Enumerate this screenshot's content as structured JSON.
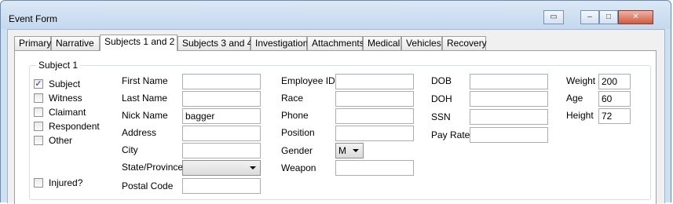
{
  "window": {
    "title": "Event Form",
    "buttons": {
      "restore_glyph": "▭",
      "minimize_glyph": "–",
      "maximize_glyph": "□",
      "close_glyph": "✕"
    }
  },
  "tabs": [
    "Primary",
    "Narrative",
    "Subjects 1 and 2",
    "Subjects 3 and 4",
    "Investigation",
    "Attachments",
    "Medical",
    "Vehicles",
    "Recovery"
  ],
  "active_tab": "Subjects 1 and 2",
  "group": {
    "title": "Subject 1",
    "checkboxes": {
      "subject": {
        "label": "Subject",
        "checked": true
      },
      "witness": {
        "label": "Witness",
        "checked": false
      },
      "claimant": {
        "label": "Claimant",
        "checked": false
      },
      "respondent": {
        "label": "Respondent",
        "checked": false
      },
      "other": {
        "label": "Other",
        "checked": false
      },
      "injured": {
        "label": "Injured?",
        "checked": false
      }
    },
    "fields": {
      "first_name": {
        "label": "First Name",
        "value": ""
      },
      "last_name": {
        "label": "Last Name",
        "value": ""
      },
      "nick_name": {
        "label": "Nick Name",
        "value": "bagger"
      },
      "address": {
        "label": "Address",
        "value": ""
      },
      "city": {
        "label": "City",
        "value": ""
      },
      "state": {
        "label": "State/Province",
        "value": ""
      },
      "postal_code": {
        "label": "Postal Code",
        "value": ""
      },
      "employee_id": {
        "label": "Employee ID",
        "value": ""
      },
      "race": {
        "label": "Race",
        "value": ""
      },
      "phone": {
        "label": "Phone",
        "value": ""
      },
      "position": {
        "label": "Position",
        "value": ""
      },
      "gender": {
        "label": "Gender",
        "value": "M"
      },
      "weapon": {
        "label": "Weapon",
        "value": ""
      },
      "dob": {
        "label": "DOB",
        "value": ""
      },
      "doh": {
        "label": "DOH",
        "value": ""
      },
      "ssn": {
        "label": "SSN",
        "value": ""
      },
      "pay_rate": {
        "label": "Pay Rate",
        "value": ""
      },
      "weight": {
        "label": "Weight",
        "value": "200"
      },
      "age": {
        "label": "Age",
        "value": "60"
      },
      "height": {
        "label": "Height",
        "value": "72"
      }
    }
  }
}
